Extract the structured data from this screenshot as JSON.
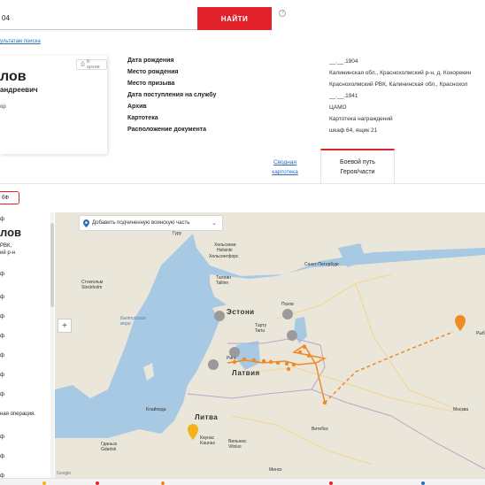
{
  "search": {
    "value": "04",
    "button": "НАЙТИ",
    "help": "?"
  },
  "back_link": "ультатам поиска",
  "person": {
    "archive_badge": "В архив",
    "surname": "лов",
    "name": "андреевич",
    "rank": "ор"
  },
  "info": {
    "rows": [
      {
        "label": "Дата рождения",
        "value": "__.__.1904"
      },
      {
        "label": "Место рождения",
        "value": "Калининская обл., Краснохолмский р-н, д. Кокорекин"
      },
      {
        "label": "Место призыва",
        "value": "Краснохолмский РВК, Калининская обл., Краснохол"
      },
      {
        "label": "Дата поступления на службу",
        "value": "__.__.1941"
      },
      {
        "label": "Архив",
        "value": "ЦАМО"
      },
      {
        "label": "Картотека",
        "value": "Картотека награждений"
      },
      {
        "label": "Расположение документа",
        "value": "шкаф 64, ящик 21"
      }
    ]
  },
  "tabs": {
    "link_line1": "Сводная",
    "link_line2": "картотека",
    "active_line1": "Боевой путь",
    "active_line2": "Героя/части"
  },
  "filter_chip": "бФ",
  "left_list": {
    "items": [
      {
        "text": "ф"
      },
      {
        "text": "РВК,"
      },
      {
        "text": "ий р-н"
      },
      {
        "text": "ф"
      },
      {
        "text": "ф"
      },
      {
        "text": "ф"
      },
      {
        "text": "ф"
      },
      {
        "text": "ф"
      },
      {
        "text": "ф"
      },
      {
        "text": "ф"
      },
      {
        "text": "ная операция."
      },
      {
        "text": "ф"
      },
      {
        "text": "ф"
      },
      {
        "text": "ф"
      }
    ],
    "surname": "лов"
  },
  "map": {
    "select_label": "Добавить подчиненную воинскую часть",
    "zoom_in": "+",
    "attribution": "Google",
    "countries": [
      {
        "text": "Эстони"
      },
      {
        "text": "Латвия"
      },
      {
        "text": "Литва"
      }
    ],
    "sea": "Балтийское море",
    "cities": [
      {
        "text": "Гуру"
      },
      {
        "text": "Хельсинки"
      },
      {
        "text": "Helsinki"
      },
      {
        "text": "Хельсингфорс"
      },
      {
        "text": "Стокгольм"
      },
      {
        "text": "Stockholm"
      },
      {
        "text": "Таллин"
      },
      {
        "text": "Tallinn"
      },
      {
        "text": "Санкт-Петербург"
      },
      {
        "text": "Тарту"
      },
      {
        "text": "Tartu"
      },
      {
        "text": "Псков"
      },
      {
        "text": "Рига"
      },
      {
        "text": "Клайпеда"
      },
      {
        "text": "Каунас"
      },
      {
        "text": "Kaunas"
      },
      {
        "text": "Вильнюс"
      },
      {
        "text": "Vilnius"
      },
      {
        "text": "Витебск"
      },
      {
        "text": "Москва"
      },
      {
        "text": "Минск"
      },
      {
        "text": "Гданьск"
      },
      {
        "text": "Gdańsk"
      },
      {
        "text": "Рыб"
      }
    ]
  },
  "colors": {
    "accent_red": "#e3232c",
    "link_blue": "#2a6db8",
    "route_orange": "#f08a24",
    "marker_yellow": "#f2b31a",
    "marker_grey": "#9a9a9a"
  }
}
